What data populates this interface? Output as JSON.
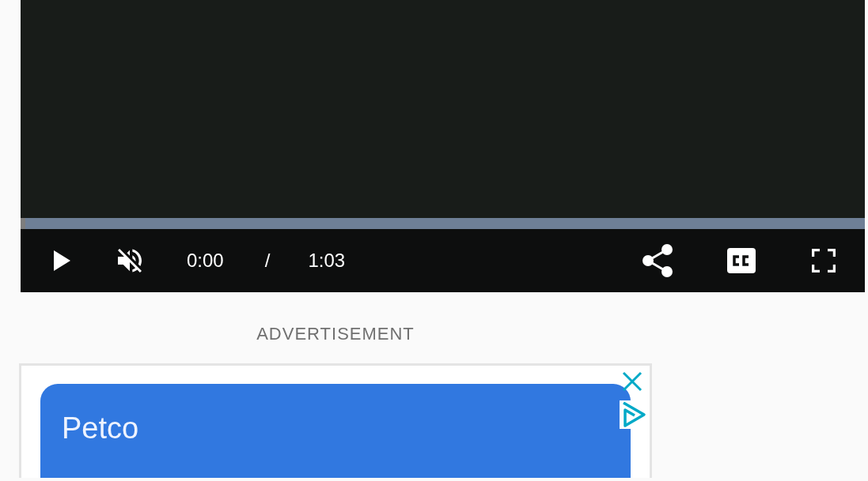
{
  "video": {
    "progress": {
      "level": 0
    },
    "muted": true,
    "current_time": "0:00",
    "separator": "/",
    "duration": "1:03"
  },
  "ad_label": "ADVERTISEMENT",
  "ad": {
    "advertiser": "Petco"
  }
}
